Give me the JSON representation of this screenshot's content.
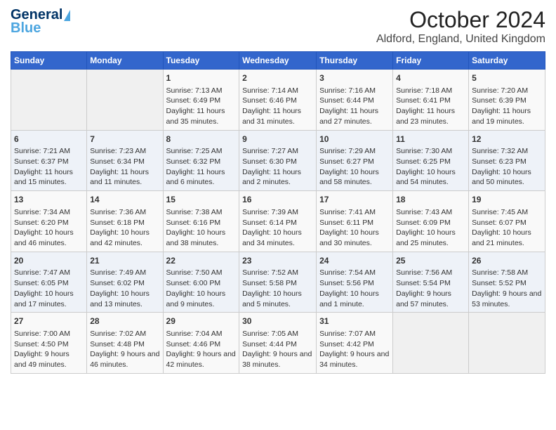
{
  "logo": {
    "line1": "General",
    "line2": "Blue"
  },
  "header": {
    "month": "October 2024",
    "location": "Aldford, England, United Kingdom"
  },
  "days_of_week": [
    "Sunday",
    "Monday",
    "Tuesday",
    "Wednesday",
    "Thursday",
    "Friday",
    "Saturday"
  ],
  "weeks": [
    [
      {
        "day": "",
        "sunrise": "",
        "sunset": "",
        "daylight": ""
      },
      {
        "day": "",
        "sunrise": "",
        "sunset": "",
        "daylight": ""
      },
      {
        "day": "1",
        "sunrise": "Sunrise: 7:13 AM",
        "sunset": "Sunset: 6:49 PM",
        "daylight": "Daylight: 11 hours and 35 minutes."
      },
      {
        "day": "2",
        "sunrise": "Sunrise: 7:14 AM",
        "sunset": "Sunset: 6:46 PM",
        "daylight": "Daylight: 11 hours and 31 minutes."
      },
      {
        "day": "3",
        "sunrise": "Sunrise: 7:16 AM",
        "sunset": "Sunset: 6:44 PM",
        "daylight": "Daylight: 11 hours and 27 minutes."
      },
      {
        "day": "4",
        "sunrise": "Sunrise: 7:18 AM",
        "sunset": "Sunset: 6:41 PM",
        "daylight": "Daylight: 11 hours and 23 minutes."
      },
      {
        "day": "5",
        "sunrise": "Sunrise: 7:20 AM",
        "sunset": "Sunset: 6:39 PM",
        "daylight": "Daylight: 11 hours and 19 minutes."
      }
    ],
    [
      {
        "day": "6",
        "sunrise": "Sunrise: 7:21 AM",
        "sunset": "Sunset: 6:37 PM",
        "daylight": "Daylight: 11 hours and 15 minutes."
      },
      {
        "day": "7",
        "sunrise": "Sunrise: 7:23 AM",
        "sunset": "Sunset: 6:34 PM",
        "daylight": "Daylight: 11 hours and 11 minutes."
      },
      {
        "day": "8",
        "sunrise": "Sunrise: 7:25 AM",
        "sunset": "Sunset: 6:32 PM",
        "daylight": "Daylight: 11 hours and 6 minutes."
      },
      {
        "day": "9",
        "sunrise": "Sunrise: 7:27 AM",
        "sunset": "Sunset: 6:30 PM",
        "daylight": "Daylight: 11 hours and 2 minutes."
      },
      {
        "day": "10",
        "sunrise": "Sunrise: 7:29 AM",
        "sunset": "Sunset: 6:27 PM",
        "daylight": "Daylight: 10 hours and 58 minutes."
      },
      {
        "day": "11",
        "sunrise": "Sunrise: 7:30 AM",
        "sunset": "Sunset: 6:25 PM",
        "daylight": "Daylight: 10 hours and 54 minutes."
      },
      {
        "day": "12",
        "sunrise": "Sunrise: 7:32 AM",
        "sunset": "Sunset: 6:23 PM",
        "daylight": "Daylight: 10 hours and 50 minutes."
      }
    ],
    [
      {
        "day": "13",
        "sunrise": "Sunrise: 7:34 AM",
        "sunset": "Sunset: 6:20 PM",
        "daylight": "Daylight: 10 hours and 46 minutes."
      },
      {
        "day": "14",
        "sunrise": "Sunrise: 7:36 AM",
        "sunset": "Sunset: 6:18 PM",
        "daylight": "Daylight: 10 hours and 42 minutes."
      },
      {
        "day": "15",
        "sunrise": "Sunrise: 7:38 AM",
        "sunset": "Sunset: 6:16 PM",
        "daylight": "Daylight: 10 hours and 38 minutes."
      },
      {
        "day": "16",
        "sunrise": "Sunrise: 7:39 AM",
        "sunset": "Sunset: 6:14 PM",
        "daylight": "Daylight: 10 hours and 34 minutes."
      },
      {
        "day": "17",
        "sunrise": "Sunrise: 7:41 AM",
        "sunset": "Sunset: 6:11 PM",
        "daylight": "Daylight: 10 hours and 30 minutes."
      },
      {
        "day": "18",
        "sunrise": "Sunrise: 7:43 AM",
        "sunset": "Sunset: 6:09 PM",
        "daylight": "Daylight: 10 hours and 25 minutes."
      },
      {
        "day": "19",
        "sunrise": "Sunrise: 7:45 AM",
        "sunset": "Sunset: 6:07 PM",
        "daylight": "Daylight: 10 hours and 21 minutes."
      }
    ],
    [
      {
        "day": "20",
        "sunrise": "Sunrise: 7:47 AM",
        "sunset": "Sunset: 6:05 PM",
        "daylight": "Daylight: 10 hours and 17 minutes."
      },
      {
        "day": "21",
        "sunrise": "Sunrise: 7:49 AM",
        "sunset": "Sunset: 6:02 PM",
        "daylight": "Daylight: 10 hours and 13 minutes."
      },
      {
        "day": "22",
        "sunrise": "Sunrise: 7:50 AM",
        "sunset": "Sunset: 6:00 PM",
        "daylight": "Daylight: 10 hours and 9 minutes."
      },
      {
        "day": "23",
        "sunrise": "Sunrise: 7:52 AM",
        "sunset": "Sunset: 5:58 PM",
        "daylight": "Daylight: 10 hours and 5 minutes."
      },
      {
        "day": "24",
        "sunrise": "Sunrise: 7:54 AM",
        "sunset": "Sunset: 5:56 PM",
        "daylight": "Daylight: 10 hours and 1 minute."
      },
      {
        "day": "25",
        "sunrise": "Sunrise: 7:56 AM",
        "sunset": "Sunset: 5:54 PM",
        "daylight": "Daylight: 9 hours and 57 minutes."
      },
      {
        "day": "26",
        "sunrise": "Sunrise: 7:58 AM",
        "sunset": "Sunset: 5:52 PM",
        "daylight": "Daylight: 9 hours and 53 minutes."
      }
    ],
    [
      {
        "day": "27",
        "sunrise": "Sunrise: 7:00 AM",
        "sunset": "Sunset: 4:50 PM",
        "daylight": "Daylight: 9 hours and 49 minutes."
      },
      {
        "day": "28",
        "sunrise": "Sunrise: 7:02 AM",
        "sunset": "Sunset: 4:48 PM",
        "daylight": "Daylight: 9 hours and 46 minutes."
      },
      {
        "day": "29",
        "sunrise": "Sunrise: 7:04 AM",
        "sunset": "Sunset: 4:46 PM",
        "daylight": "Daylight: 9 hours and 42 minutes."
      },
      {
        "day": "30",
        "sunrise": "Sunrise: 7:05 AM",
        "sunset": "Sunset: 4:44 PM",
        "daylight": "Daylight: 9 hours and 38 minutes."
      },
      {
        "day": "31",
        "sunrise": "Sunrise: 7:07 AM",
        "sunset": "Sunset: 4:42 PM",
        "daylight": "Daylight: 9 hours and 34 minutes."
      },
      {
        "day": "",
        "sunrise": "",
        "sunset": "",
        "daylight": ""
      },
      {
        "day": "",
        "sunrise": "",
        "sunset": "",
        "daylight": ""
      }
    ]
  ]
}
